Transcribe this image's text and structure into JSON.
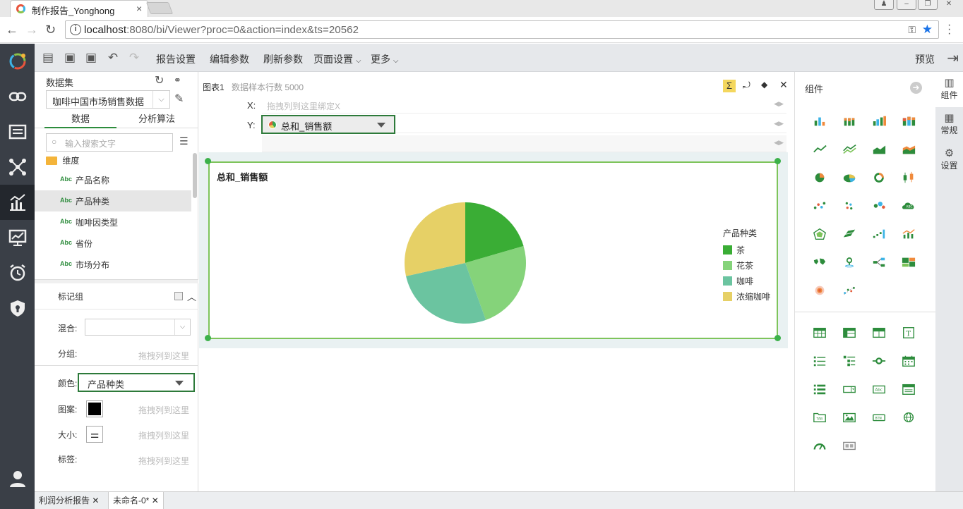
{
  "browser": {
    "tab_title": "制作报告_Yonghong",
    "tab_close": "×",
    "url_host": "localhost",
    "url_rest": ":8080/bi/Viewer?proc=0&action=index&ts=20562"
  },
  "toolbar": {
    "report_settings": "报告设置",
    "edit_params": "编辑参数",
    "refresh_params": "刷新参数",
    "page_settings": "页面设置",
    "more": "更多",
    "preview": "预览"
  },
  "data_panel": {
    "dataset_label": "数据集",
    "dataset_value": "咖啡中国市场销售数据",
    "tab_data": "数据",
    "tab_algo": "分析算法",
    "search_placeholder": "输入搜索文字",
    "dimension_folder": "维度",
    "fields": [
      {
        "type": "Abc",
        "name": "产品名称"
      },
      {
        "type": "Abc",
        "name": "产品种类"
      },
      {
        "type": "Abc",
        "name": "咖啡因类型"
      },
      {
        "type": "Abc",
        "name": "省份"
      },
      {
        "type": "Abc",
        "name": "市场分布"
      }
    ],
    "mark_group": "标记组",
    "mix_label": "混合:",
    "group_label": "分组:",
    "drop_hint": "拖拽列到这里",
    "color_label": "颜色:",
    "color_value": "产品种类",
    "pattern_label": "图案:",
    "size_label": "大小:",
    "tag_label": "标签:"
  },
  "chart_panel": {
    "chart_name": "图表1",
    "sample_rows": "数据样本行数 5000",
    "x_label": "X:",
    "x_placeholder": "拖拽列到这里绑定X",
    "y_label": "Y:",
    "y_value": "总和_销售额"
  },
  "chart_data": {
    "type": "pie",
    "title": "总和_销售额",
    "legend_title": "产品种类",
    "legend_position": "right",
    "categories": [
      "茶",
      "花茶",
      "咖啡",
      "浓缩咖啡"
    ],
    "values": [
      20.5,
      24.0,
      27.0,
      28.5
    ],
    "colors": [
      "#3aad35",
      "#85d37a",
      "#6bc4a0",
      "#e6d066"
    ]
  },
  "component_panel": {
    "title": "组件"
  },
  "right_tabs": [
    {
      "icon": "bar-chart-icon",
      "label": "组件"
    },
    {
      "icon": "grid-icon",
      "label": "常规"
    },
    {
      "icon": "gear-icon",
      "label": "设置"
    }
  ],
  "bottom_tabs": [
    {
      "label": "利润分析报告"
    },
    {
      "label": "未命名-0*"
    }
  ]
}
